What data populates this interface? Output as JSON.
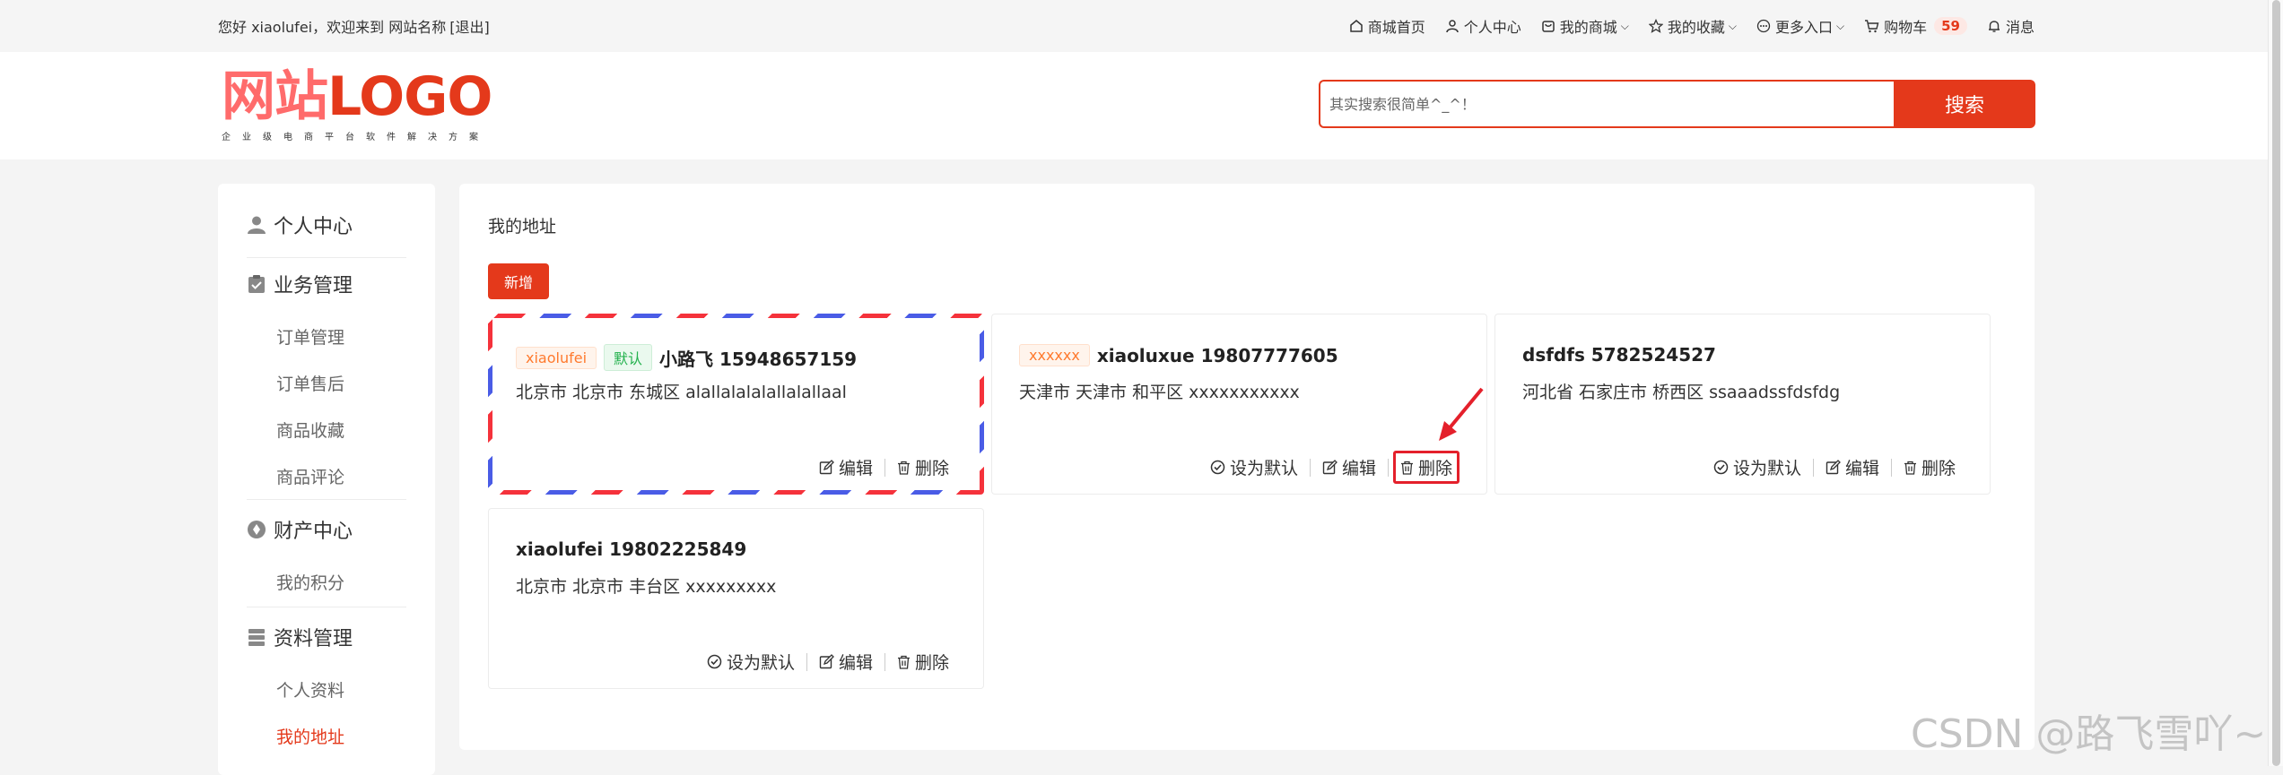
{
  "topbar": {
    "welcome": "您好 xiaolufei，欢迎来到 网站名称",
    "logout": "[退出]",
    "nav": {
      "home": "商城首页",
      "user_center": "个人中心",
      "my_mall": "我的商城",
      "favorites": "我的收藏",
      "more": "更多入口",
      "cart": "购物车",
      "cart_count": "59",
      "messages": "消息"
    }
  },
  "header": {
    "logo_cn": "网站",
    "logo_en": "LOGO",
    "slogan": "企业级电商平台软件解决方案",
    "search_placeholder": "其实搜索很简单^_^！",
    "search_button": "搜索"
  },
  "sidebar": {
    "groups": [
      {
        "title": "个人中心",
        "icon": "user-icon",
        "items": []
      },
      {
        "title": "业务管理",
        "icon": "clipboard-icon",
        "items": [
          "订单管理",
          "订单售后",
          "商品收藏",
          "商品评论"
        ]
      },
      {
        "title": "财产中心",
        "icon": "coin-icon",
        "items": [
          "我的积分"
        ]
      },
      {
        "title": "资料管理",
        "icon": "database-icon",
        "items": [
          "个人资料",
          "我的地址"
        ]
      }
    ],
    "active_item": "我的地址"
  },
  "main": {
    "title": "我的地址",
    "add_button": "新增",
    "addresses": [
      {
        "tag": "xiaolufei",
        "default_tag": "默认",
        "name_phone": "小路飞 15948657159",
        "address": "北京市 北京市 东城区 alallalalalallalallaal",
        "is_default": true
      },
      {
        "tag": "xxxxxx",
        "name_phone": "xiaoluxue 19807777605",
        "address": "天津市 天津市 和平区 xxxxxxxxxxx",
        "is_default": false
      },
      {
        "name_phone": "dsfdfs 5782524527",
        "address": "河北省 石家庄市 桥西区 ssaaadssfdsfdg",
        "is_default": false
      },
      {
        "name_phone": "xiaolufei 19802225849",
        "address": "北京市 北京市 丰台区 xxxxxxxxx",
        "is_default": false
      }
    ],
    "actions": {
      "set_default": "设为默认",
      "edit": "编辑",
      "delete": "删除"
    }
  },
  "watermark": "CSDN @路飞雪吖~",
  "colors": {
    "accent": "#e4391b",
    "tag_orange": "#ff7a2e",
    "tag_green": "#22b14c",
    "highlight": "#e4202b"
  }
}
